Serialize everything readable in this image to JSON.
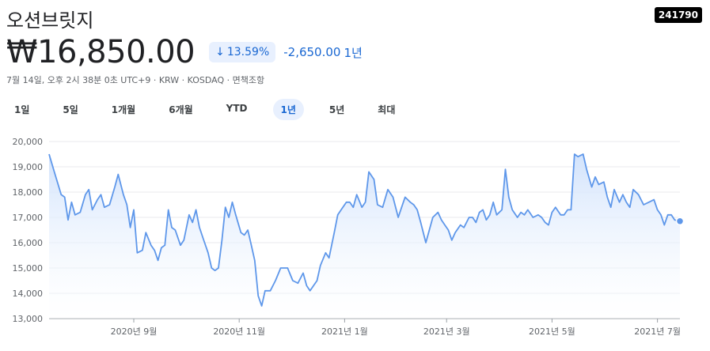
{
  "header": {
    "title": "오션브릿지",
    "ticker": "241790",
    "price": "₩16,850.00",
    "change_pct": "13.59%",
    "change_abs": "-2,650.00",
    "period": "1년",
    "meta": "7월 14일, 오후 2시 38분 0초 UTC+9 · KRW · KOSDAQ · 면책조항"
  },
  "tabs": [
    "1일",
    "5일",
    "1개월",
    "6개월",
    "YTD",
    "1년",
    "5년",
    "최대"
  ],
  "active_tab_index": 5,
  "colors": {
    "line": "#5e97ea",
    "fill_top": "#d2e3fc",
    "grid": "#e8eaed",
    "accent": "#1967d2"
  },
  "chart_data": {
    "type": "area",
    "ylim": [
      13000,
      20000
    ],
    "yticks": [
      13000,
      14000,
      15000,
      16000,
      17000,
      18000,
      19000,
      20000
    ],
    "ytick_labels": [
      "13,000",
      "14,000",
      "15,000",
      "16,000",
      "17,000",
      "18,000",
      "19,000",
      "20,000"
    ],
    "xlim": [
      "2020-07-14",
      "2021-07-14"
    ],
    "xticks": [
      "2020-09-01",
      "2020-11-01",
      "2021-01-01",
      "2021-03-01",
      "2021-05-01",
      "2021-07-01"
    ],
    "xtick_labels": [
      "2020년 9월",
      "2020년 11월",
      "2021년 1월",
      "2021년 3월",
      "2021년 5월",
      "2021년 7월"
    ],
    "series": [
      {
        "points": [
          [
            "2020-07-14",
            19500
          ],
          [
            "2020-07-17",
            18800
          ],
          [
            "2020-07-21",
            17900
          ],
          [
            "2020-07-23",
            17800
          ],
          [
            "2020-07-25",
            16900
          ],
          [
            "2020-07-27",
            17600
          ],
          [
            "2020-07-29",
            17100
          ],
          [
            "2020-08-01",
            17200
          ],
          [
            "2020-08-04",
            17900
          ],
          [
            "2020-08-06",
            18100
          ],
          [
            "2020-08-08",
            17300
          ],
          [
            "2020-08-11",
            17700
          ],
          [
            "2020-08-13",
            17900
          ],
          [
            "2020-08-15",
            17400
          ],
          [
            "2020-08-18",
            17500
          ],
          [
            "2020-08-21",
            18200
          ],
          [
            "2020-08-23",
            18700
          ],
          [
            "2020-08-26",
            17900
          ],
          [
            "2020-08-28",
            17500
          ],
          [
            "2020-08-30",
            16600
          ],
          [
            "2020-09-01",
            17300
          ],
          [
            "2020-09-03",
            15600
          ],
          [
            "2020-09-06",
            15700
          ],
          [
            "2020-09-08",
            16400
          ],
          [
            "2020-09-11",
            15900
          ],
          [
            "2020-09-13",
            15700
          ],
          [
            "2020-09-15",
            15300
          ],
          [
            "2020-09-17",
            15800
          ],
          [
            "2020-09-19",
            15900
          ],
          [
            "2020-09-21",
            17300
          ],
          [
            "2020-09-23",
            16600
          ],
          [
            "2020-09-25",
            16500
          ],
          [
            "2020-09-28",
            15900
          ],
          [
            "2020-09-30",
            16100
          ],
          [
            "2020-10-03",
            17100
          ],
          [
            "2020-10-05",
            16800
          ],
          [
            "2020-10-07",
            17300
          ],
          [
            "2020-10-09",
            16600
          ],
          [
            "2020-10-11",
            16200
          ],
          [
            "2020-10-14",
            15600
          ],
          [
            "2020-10-16",
            15000
          ],
          [
            "2020-10-18",
            14900
          ],
          [
            "2020-10-20",
            15000
          ],
          [
            "2020-10-22",
            16100
          ],
          [
            "2020-10-24",
            17400
          ],
          [
            "2020-10-26",
            17000
          ],
          [
            "2020-10-28",
            17600
          ],
          [
            "2020-10-30",
            17100
          ],
          [
            "2020-11-02",
            16400
          ],
          [
            "2020-11-04",
            16300
          ],
          [
            "2020-11-06",
            16500
          ],
          [
            "2020-11-08",
            15900
          ],
          [
            "2020-11-10",
            15300
          ],
          [
            "2020-11-12",
            13900
          ],
          [
            "2020-11-14",
            13500
          ],
          [
            "2020-11-16",
            14100
          ],
          [
            "2020-11-19",
            14100
          ],
          [
            "2020-11-22",
            14500
          ],
          [
            "2020-11-25",
            15000
          ],
          [
            "2020-11-29",
            15000
          ],
          [
            "2020-12-02",
            14500
          ],
          [
            "2020-12-05",
            14400
          ],
          [
            "2020-12-08",
            14800
          ],
          [
            "2020-12-10",
            14300
          ],
          [
            "2020-12-12",
            14100
          ],
          [
            "2020-12-14",
            14300
          ],
          [
            "2020-12-16",
            14500
          ],
          [
            "2020-12-18",
            15100
          ],
          [
            "2020-12-21",
            15600
          ],
          [
            "2020-12-23",
            15400
          ],
          [
            "2020-12-26",
            16400
          ],
          [
            "2020-12-28",
            17100
          ],
          [
            "2020-12-30",
            17300
          ],
          [
            "2021-01-02",
            17600
          ],
          [
            "2021-01-04",
            17600
          ],
          [
            "2021-01-06",
            17400
          ],
          [
            "2021-01-08",
            17900
          ],
          [
            "2021-01-11",
            17400
          ],
          [
            "2021-01-13",
            17600
          ],
          [
            "2021-01-15",
            18800
          ],
          [
            "2021-01-18",
            18500
          ],
          [
            "2021-01-20",
            17500
          ],
          [
            "2021-01-23",
            17400
          ],
          [
            "2021-01-26",
            18100
          ],
          [
            "2021-01-29",
            17800
          ],
          [
            "2021-02-01",
            17000
          ],
          [
            "2021-02-03",
            17400
          ],
          [
            "2021-02-05",
            17800
          ],
          [
            "2021-02-08",
            17600
          ],
          [
            "2021-02-10",
            17500
          ],
          [
            "2021-02-12",
            17300
          ],
          [
            "2021-02-14",
            16800
          ],
          [
            "2021-02-17",
            16000
          ],
          [
            "2021-02-19",
            16500
          ],
          [
            "2021-02-21",
            17000
          ],
          [
            "2021-02-24",
            17200
          ],
          [
            "2021-02-26",
            16900
          ],
          [
            "2021-02-28",
            16700
          ],
          [
            "2021-03-02",
            16500
          ],
          [
            "2021-03-04",
            16100
          ],
          [
            "2021-03-06",
            16400
          ],
          [
            "2021-03-09",
            16700
          ],
          [
            "2021-03-11",
            16600
          ],
          [
            "2021-03-14",
            17000
          ],
          [
            "2021-03-16",
            17000
          ],
          [
            "2021-03-18",
            16800
          ],
          [
            "2021-03-20",
            17200
          ],
          [
            "2021-03-22",
            17300
          ],
          [
            "2021-03-24",
            16900
          ],
          [
            "2021-03-26",
            17100
          ],
          [
            "2021-03-28",
            17600
          ],
          [
            "2021-03-30",
            17100
          ],
          [
            "2021-04-02",
            17300
          ],
          [
            "2021-04-04",
            18900
          ],
          [
            "2021-04-06",
            17800
          ],
          [
            "2021-04-08",
            17300
          ],
          [
            "2021-04-11",
            17000
          ],
          [
            "2021-04-13",
            17200
          ],
          [
            "2021-04-15",
            17100
          ],
          [
            "2021-04-17",
            17300
          ],
          [
            "2021-04-20",
            17000
          ],
          [
            "2021-04-23",
            17100
          ],
          [
            "2021-04-25",
            17000
          ],
          [
            "2021-04-27",
            16800
          ],
          [
            "2021-04-29",
            16700
          ],
          [
            "2021-05-01",
            17200
          ],
          [
            "2021-05-03",
            17400
          ],
          [
            "2021-05-06",
            17100
          ],
          [
            "2021-05-08",
            17100
          ],
          [
            "2021-05-10",
            17300
          ],
          [
            "2021-05-12",
            17300
          ],
          [
            "2021-05-14",
            19500
          ],
          [
            "2021-05-16",
            19400
          ],
          [
            "2021-05-19",
            19500
          ],
          [
            "2021-05-21",
            18900
          ],
          [
            "2021-05-24",
            18200
          ],
          [
            "2021-05-26",
            18600
          ],
          [
            "2021-05-28",
            18300
          ],
          [
            "2021-05-31",
            18400
          ],
          [
            "2021-06-02",
            17800
          ],
          [
            "2021-06-04",
            17400
          ],
          [
            "2021-06-06",
            18100
          ],
          [
            "2021-06-09",
            17600
          ],
          [
            "2021-06-11",
            17900
          ],
          [
            "2021-06-13",
            17600
          ],
          [
            "2021-06-15",
            17400
          ],
          [
            "2021-06-17",
            18100
          ],
          [
            "2021-06-20",
            17900
          ],
          [
            "2021-06-23",
            17500
          ],
          [
            "2021-06-26",
            17600
          ],
          [
            "2021-06-29",
            17700
          ],
          [
            "2021-07-01",
            17300
          ],
          [
            "2021-07-03",
            17100
          ],
          [
            "2021-07-05",
            16700
          ],
          [
            "2021-07-07",
            17100
          ],
          [
            "2021-07-09",
            17100
          ],
          [
            "2021-07-11",
            16900
          ],
          [
            "2021-07-14",
            16850
          ]
        ]
      }
    ],
    "last_point": [
      "2021-07-14",
      16850
    ]
  }
}
